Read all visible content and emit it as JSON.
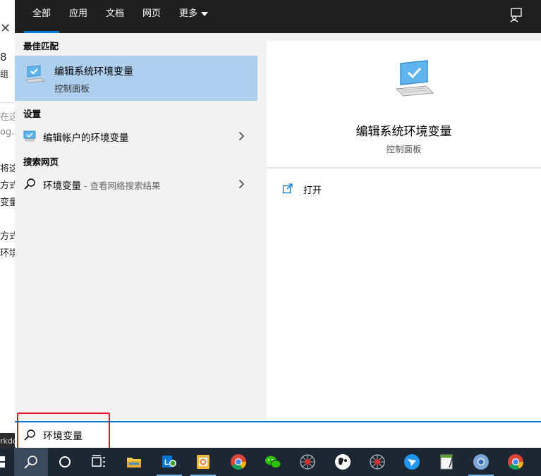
{
  "background_app": {
    "fragments": [
      "8",
      "组",
      "在这",
      "og.",
      "将这",
      "方式",
      "变量",
      "方式",
      "环境"
    ],
    "strip_text": "rkdc"
  },
  "tabs": [
    {
      "label": "全部",
      "active": true
    },
    {
      "label": "应用",
      "active": false
    },
    {
      "label": "文档",
      "active": false
    },
    {
      "label": "网页",
      "active": false
    },
    {
      "label": "更多",
      "active": false
    }
  ],
  "left": {
    "best_match_heading": "最佳匹配",
    "best_match": {
      "title": "编辑系统环境变量",
      "subtitle": "控制面板",
      "icon": "monitor-check-icon"
    },
    "settings_heading": "设置",
    "settings_item": {
      "label": "编辑帐户的环境变量",
      "icon": "monitor-settings-icon"
    },
    "web_heading": "搜索网页",
    "web_item": {
      "label": "环境变量",
      "suffix": " - 查看网络搜索结果",
      "icon": "search-icon"
    }
  },
  "right": {
    "title": "编辑系统环境变量",
    "subtitle": "控制面板",
    "open_label": "打开"
  },
  "search": {
    "value": "环境变量"
  },
  "colors": {
    "accent": "#0078d7",
    "highlight": "#aed0ee",
    "annotation": "#e81123",
    "taskbar": "#1c2733"
  },
  "taskbar": {
    "items": [
      "windows-start-icon",
      "search-icon",
      "cortana-icon",
      "task-view-icon",
      "file-explorer-icon",
      "lync-icon",
      "outlook-icon",
      "chrome-icon",
      "wechat-icon",
      "spider-icon",
      "cow-icon",
      "spider-icon",
      "feishu-icon",
      "notepad-icon",
      "chrome-canary-icon",
      "chrome-icon"
    ]
  }
}
